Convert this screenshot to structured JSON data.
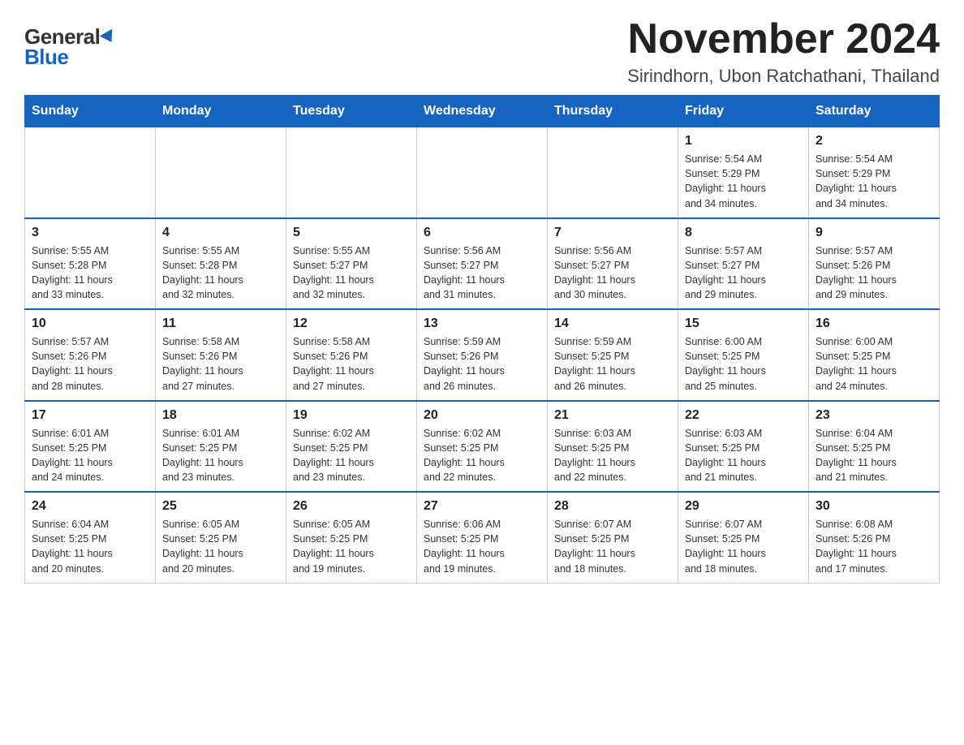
{
  "logo": {
    "general": "General",
    "blue": "Blue"
  },
  "title": "November 2024",
  "location": "Sirindhorn, Ubon Ratchathani, Thailand",
  "weekdays": [
    "Sunday",
    "Monday",
    "Tuesday",
    "Wednesday",
    "Thursday",
    "Friday",
    "Saturday"
  ],
  "weeks": [
    [
      {
        "day": "",
        "info": ""
      },
      {
        "day": "",
        "info": ""
      },
      {
        "day": "",
        "info": ""
      },
      {
        "day": "",
        "info": ""
      },
      {
        "day": "",
        "info": ""
      },
      {
        "day": "1",
        "info": "Sunrise: 5:54 AM\nSunset: 5:29 PM\nDaylight: 11 hours\nand 34 minutes."
      },
      {
        "day": "2",
        "info": "Sunrise: 5:54 AM\nSunset: 5:29 PM\nDaylight: 11 hours\nand 34 minutes."
      }
    ],
    [
      {
        "day": "3",
        "info": "Sunrise: 5:55 AM\nSunset: 5:28 PM\nDaylight: 11 hours\nand 33 minutes."
      },
      {
        "day": "4",
        "info": "Sunrise: 5:55 AM\nSunset: 5:28 PM\nDaylight: 11 hours\nand 32 minutes."
      },
      {
        "day": "5",
        "info": "Sunrise: 5:55 AM\nSunset: 5:27 PM\nDaylight: 11 hours\nand 32 minutes."
      },
      {
        "day": "6",
        "info": "Sunrise: 5:56 AM\nSunset: 5:27 PM\nDaylight: 11 hours\nand 31 minutes."
      },
      {
        "day": "7",
        "info": "Sunrise: 5:56 AM\nSunset: 5:27 PM\nDaylight: 11 hours\nand 30 minutes."
      },
      {
        "day": "8",
        "info": "Sunrise: 5:57 AM\nSunset: 5:27 PM\nDaylight: 11 hours\nand 29 minutes."
      },
      {
        "day": "9",
        "info": "Sunrise: 5:57 AM\nSunset: 5:26 PM\nDaylight: 11 hours\nand 29 minutes."
      }
    ],
    [
      {
        "day": "10",
        "info": "Sunrise: 5:57 AM\nSunset: 5:26 PM\nDaylight: 11 hours\nand 28 minutes."
      },
      {
        "day": "11",
        "info": "Sunrise: 5:58 AM\nSunset: 5:26 PM\nDaylight: 11 hours\nand 27 minutes."
      },
      {
        "day": "12",
        "info": "Sunrise: 5:58 AM\nSunset: 5:26 PM\nDaylight: 11 hours\nand 27 minutes."
      },
      {
        "day": "13",
        "info": "Sunrise: 5:59 AM\nSunset: 5:26 PM\nDaylight: 11 hours\nand 26 minutes."
      },
      {
        "day": "14",
        "info": "Sunrise: 5:59 AM\nSunset: 5:25 PM\nDaylight: 11 hours\nand 26 minutes."
      },
      {
        "day": "15",
        "info": "Sunrise: 6:00 AM\nSunset: 5:25 PM\nDaylight: 11 hours\nand 25 minutes."
      },
      {
        "day": "16",
        "info": "Sunrise: 6:00 AM\nSunset: 5:25 PM\nDaylight: 11 hours\nand 24 minutes."
      }
    ],
    [
      {
        "day": "17",
        "info": "Sunrise: 6:01 AM\nSunset: 5:25 PM\nDaylight: 11 hours\nand 24 minutes."
      },
      {
        "day": "18",
        "info": "Sunrise: 6:01 AM\nSunset: 5:25 PM\nDaylight: 11 hours\nand 23 minutes."
      },
      {
        "day": "19",
        "info": "Sunrise: 6:02 AM\nSunset: 5:25 PM\nDaylight: 11 hours\nand 23 minutes."
      },
      {
        "day": "20",
        "info": "Sunrise: 6:02 AM\nSunset: 5:25 PM\nDaylight: 11 hours\nand 22 minutes."
      },
      {
        "day": "21",
        "info": "Sunrise: 6:03 AM\nSunset: 5:25 PM\nDaylight: 11 hours\nand 22 minutes."
      },
      {
        "day": "22",
        "info": "Sunrise: 6:03 AM\nSunset: 5:25 PM\nDaylight: 11 hours\nand 21 minutes."
      },
      {
        "day": "23",
        "info": "Sunrise: 6:04 AM\nSunset: 5:25 PM\nDaylight: 11 hours\nand 21 minutes."
      }
    ],
    [
      {
        "day": "24",
        "info": "Sunrise: 6:04 AM\nSunset: 5:25 PM\nDaylight: 11 hours\nand 20 minutes."
      },
      {
        "day": "25",
        "info": "Sunrise: 6:05 AM\nSunset: 5:25 PM\nDaylight: 11 hours\nand 20 minutes."
      },
      {
        "day": "26",
        "info": "Sunrise: 6:05 AM\nSunset: 5:25 PM\nDaylight: 11 hours\nand 19 minutes."
      },
      {
        "day": "27",
        "info": "Sunrise: 6:06 AM\nSunset: 5:25 PM\nDaylight: 11 hours\nand 19 minutes."
      },
      {
        "day": "28",
        "info": "Sunrise: 6:07 AM\nSunset: 5:25 PM\nDaylight: 11 hours\nand 18 minutes."
      },
      {
        "day": "29",
        "info": "Sunrise: 6:07 AM\nSunset: 5:25 PM\nDaylight: 11 hours\nand 18 minutes."
      },
      {
        "day": "30",
        "info": "Sunrise: 6:08 AM\nSunset: 5:26 PM\nDaylight: 11 hours\nand 17 minutes."
      }
    ]
  ]
}
